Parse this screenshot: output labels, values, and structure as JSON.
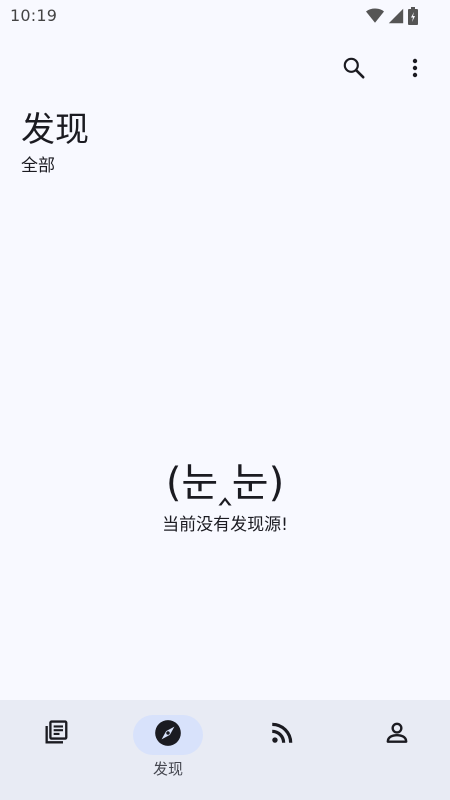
{
  "status_bar": {
    "time": "10:19",
    "icons": [
      "wifi-icon",
      "cell-signal-icon",
      "battery-charging-icon"
    ]
  },
  "app_bar": {
    "actions": [
      "search-icon",
      "more-vert-icon"
    ]
  },
  "header": {
    "title": "发现",
    "subtitle": "全部"
  },
  "empty_state": {
    "face": "(눈‸눈)",
    "message": "当前没有发现源!"
  },
  "bottom_nav": {
    "items": [
      {
        "icon": "library-books-icon",
        "label": "",
        "active": false
      },
      {
        "icon": "explore-compass-icon",
        "label": "发现",
        "active": true
      },
      {
        "icon": "rss-feed-icon",
        "label": "",
        "active": false
      },
      {
        "icon": "person-icon",
        "label": "",
        "active": false
      }
    ]
  },
  "colors": {
    "background": "#f8f9ff",
    "nav_background": "#e8ebf4",
    "active_indicator": "#d8e2fb",
    "text_primary": "#1b1b21",
    "icon": "#1b1b21"
  }
}
